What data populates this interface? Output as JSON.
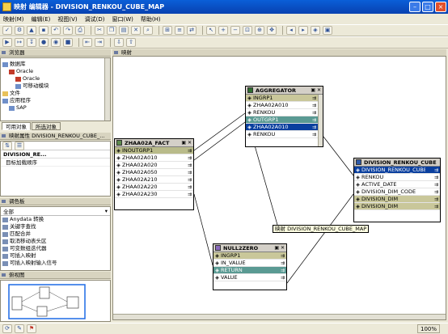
{
  "window": {
    "title": "映射 编辑器 - DIVISION_RENKOU_CUBE_MAP"
  },
  "menu": [
    "映射(M)",
    "编辑(E)",
    "视图(V)",
    "调试(D)",
    "窗口(W)",
    "帮助(H)"
  ],
  "browser": {
    "header": "浏览器",
    "tree": [
      {
        "label": "数据库",
        "icon": "database-icon",
        "indent": 0
      },
      {
        "label": "Oracle",
        "icon": "oracle-icon",
        "indent": 1
      },
      {
        "label": "Oracle",
        "icon": "oracle-icon",
        "indent": 2
      },
      {
        "label": "可移动模块",
        "icon": "module-icon",
        "indent": 2
      },
      {
        "label": "文件",
        "icon": "folder-icon",
        "indent": 0
      },
      {
        "label": "应用程序",
        "icon": "app-icon",
        "indent": 0
      },
      {
        "label": "SAP",
        "icon": "sap-icon",
        "indent": 1
      }
    ],
    "tabs": [
      "可用对象",
      "所选对象"
    ]
  },
  "properties": {
    "header": "映射属性 DIVISION_RENKOU_CUBE_...",
    "name_value": "DIVISION_RE...",
    "load_label": "目标加载顺序"
  },
  "palette": {
    "header": "调色板",
    "filter": "全部",
    "items": [
      {
        "label": "Anydata 转换",
        "icon": "anydata-icon"
      },
      {
        "label": "关键字查找",
        "icon": "key-lookup-icon"
      },
      {
        "label": "匹配合并",
        "icon": "match-merge-icon"
      },
      {
        "label": "取消移动表头区",
        "icon": "unpivot-icon"
      },
      {
        "label": "可变数组迭代器",
        "icon": "varray-icon"
      },
      {
        "label": "可插入映射",
        "icon": "pluggable-icon"
      },
      {
        "label": "可插入映射输入信号",
        "icon": "pluggable-input-icon"
      }
    ]
  },
  "bird_eye": {
    "header": "俯视图"
  },
  "canvas": {
    "header": "映射",
    "tooltip": "映射 DIVISION_RENKOU_CUBE_MAP"
  },
  "operators": {
    "zhaa": {
      "title": "ZHAA02A_FACT",
      "ports": [
        {
          "label": "INOUTGRP1",
          "kind": "group"
        },
        {
          "label": "ZHAA02A010",
          "kind": "normal"
        },
        {
          "label": "ZHAA02A020",
          "kind": "normal"
        },
        {
          "label": "ZHAA02A050",
          "kind": "normal"
        },
        {
          "label": "ZHAA02A210",
          "kind": "normal"
        },
        {
          "label": "ZHAA02A220",
          "kind": "normal"
        },
        {
          "label": "ZHAA02A230",
          "kind": "normal"
        }
      ]
    },
    "aggregator": {
      "title": "AGGREGATOR",
      "ports": [
        {
          "label": "INGRP1",
          "kind": "vio"
        },
        {
          "label": "ZHAA02A010",
          "kind": "normal"
        },
        {
          "label": "RENKOU",
          "kind": "normal"
        },
        {
          "label": "OUTGRP1",
          "kind": "group2"
        },
        {
          "label": "ZHAA02A010",
          "kind": "sel"
        },
        {
          "label": "RENKOU",
          "kind": "normal"
        }
      ]
    },
    "nullzero": {
      "title": "NULL2ZERO",
      "ports": [
        {
          "label": "INGRP1",
          "kind": "vio"
        },
        {
          "label": "IN_VALUE",
          "kind": "normal"
        },
        {
          "label": "RETURN",
          "kind": "group2"
        },
        {
          "label": "VALUE",
          "kind": "normal"
        }
      ]
    },
    "division": {
      "title": "DIVISION_RENKOU_CUBE",
      "ports": [
        {
          "label": "DIVISION_RENKOU_CUBE",
          "kind": "sel"
        },
        {
          "label": "RENKOU",
          "kind": "normal"
        },
        {
          "label": "ACTIVE_DATE",
          "kind": "normal"
        },
        {
          "label": "DIVISION_DIM_CODE",
          "kind": "normal"
        },
        {
          "label": "DIVISION_DIM",
          "kind": "vio"
        },
        {
          "label": "DIVISION_DIM",
          "kind": "vio"
        }
      ]
    }
  },
  "status": {
    "zoom": "100%"
  }
}
